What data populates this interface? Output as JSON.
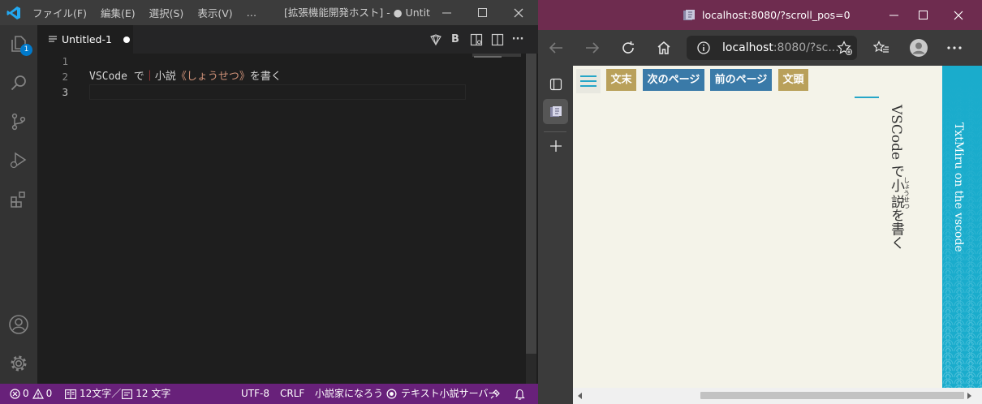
{
  "vscode": {
    "menu": [
      "ファイル(F)",
      "編集(E)",
      "選択(S)",
      "表示(V)",
      "…"
    ],
    "window_title": "[拡張機能開発ホスト] - ● Untitle…",
    "explorer_badge": "1",
    "tab": {
      "label": "Untitled-1",
      "dirty": true
    },
    "tab_actions": {
      "bold_label": "B",
      "more_label": "···"
    },
    "editor": {
      "line_numbers": [
        "1",
        "2",
        "3"
      ],
      "active_line": 3,
      "line2": {
        "plain_text": "VSCode で",
        "ruby_marker": "｜",
        "ruby_base": "小説",
        "ruby_open": "《",
        "ruby_reading": "しょうせつ",
        "ruby_close": "》",
        "trailing": "を書く"
      }
    },
    "status": {
      "errors": "0",
      "warnings": "0",
      "char_count": "12文字／",
      "char_count2": "12 文字",
      "encoding": "UTF-8",
      "eol": "CRLF",
      "mode": "小説家になろう",
      "server": "テキスト小説サーバー"
    },
    "colors": {
      "status_bar": "#68217a",
      "ruby_marker": "#f14c4c",
      "ruby_text": "#ce9178"
    }
  },
  "browser": {
    "title": "localhost:8080/?scroll_pos=0",
    "address": {
      "host": "localhost",
      "path": ":8080/?sc..."
    },
    "page_buttons": [
      "文末",
      "次のページ",
      "前のページ",
      "文頭"
    ],
    "vertical_text": {
      "before": "VSCode で",
      "base": "小説",
      "ruby": "しょうせつ",
      "after": "を書く"
    },
    "band_text": "TxtMiru on the vscode",
    "colors": {
      "titlebar": "#6e2c4f",
      "band": "#1aaccc",
      "gold_button": "#b9a05a",
      "blue_button": "#3a7aa8"
    }
  }
}
